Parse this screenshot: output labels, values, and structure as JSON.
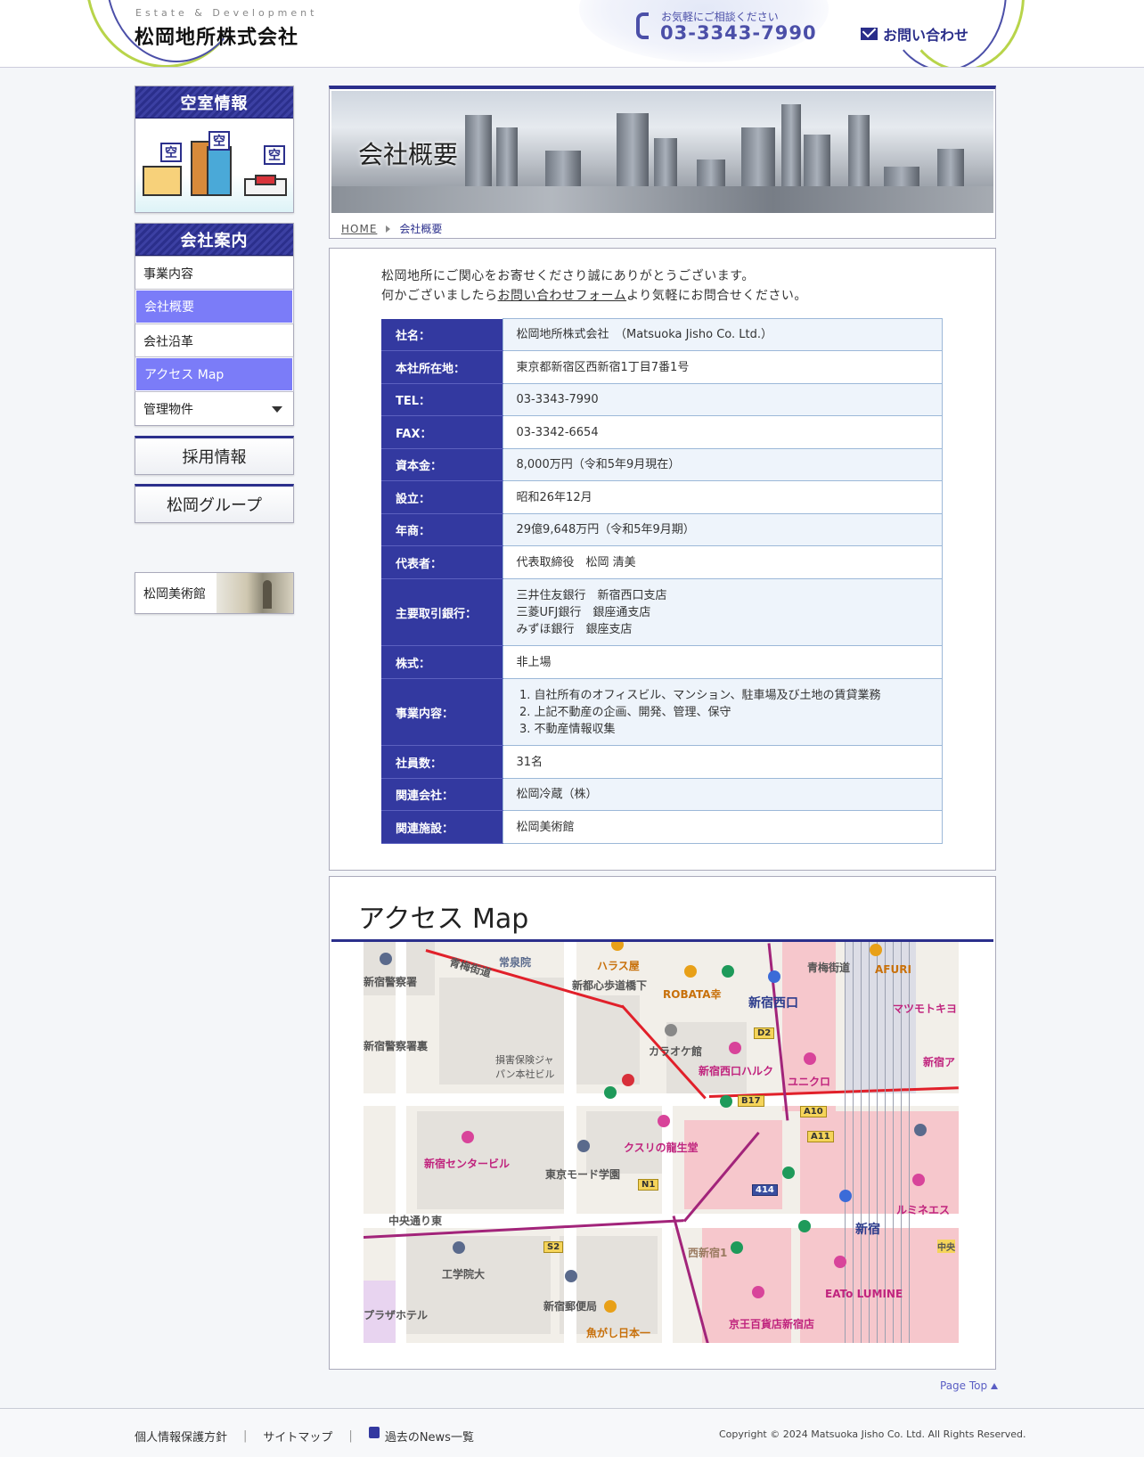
{
  "header": {
    "logo_sub": "Estate & Development",
    "logo_main": "松岡地所株式会社",
    "tel_note": "お気軽にご相談ください",
    "tel_number": "03-3343-7990",
    "contact_label": "お問い合わせ"
  },
  "sidebar": {
    "vacancy_title": "空室情報",
    "vacancy_signs": [
      "空",
      "空",
      "空"
    ],
    "company_title": "会社案内",
    "items": [
      {
        "label": "事業内容",
        "active": false
      },
      {
        "label": "会社概要",
        "active": true
      },
      {
        "label": "会社沿革",
        "active": false
      },
      {
        "label": "アクセス Map",
        "active": true
      },
      {
        "label": "管理物件",
        "active": false
      }
    ],
    "recruit_label": "採用情報",
    "group_label": "松岡グループ",
    "museum_label": "松岡美術館"
  },
  "hero": {
    "title": "会社概要",
    "breadcrumb_home": "HOME",
    "breadcrumb_current": "会社概要"
  },
  "intro": {
    "line1": "松岡地所にご関心をお寄せくださり誠にありがとうございます。",
    "line2_pre": "何かございましたら",
    "line2_link": "お問い合わせフォーム",
    "line2_post": "より気軽にお問合せください。"
  },
  "profile": {
    "rows": [
      {
        "label": "社名：",
        "value": "松岡地所株式会社　（Matsuoka Jisho Co. Ltd.）"
      },
      {
        "label": "本社所在地：",
        "value": "東京都新宿区西新宿1丁目7番1号"
      },
      {
        "label": "TEL：",
        "value": "03-3343-7990"
      },
      {
        "label": "FAX：",
        "value": "03-3342-6654"
      },
      {
        "label": "資本金：",
        "value": "8,000万円（令和5年9月現在）"
      },
      {
        "label": "設立：",
        "value": "昭和26年12月"
      },
      {
        "label": "年商：",
        "value": "29億9,648万円（令和5年9月期）"
      },
      {
        "label": "代表者：",
        "value": "代表取締役　松岡 清美"
      },
      {
        "label": "主要取引銀行：",
        "lines": [
          "三井住友銀行　新宿西口支店",
          "三菱UFJ銀行　銀座通支店",
          "みずほ銀行　銀座支店"
        ]
      },
      {
        "label": "株式：",
        "value": "非上場"
      },
      {
        "label": "事業内容：",
        "list": [
          "自社所有のオフィスビル、マンション、駐車場及び土地の賃貸業務",
          "上記不動産の企画、開発、管理、保守",
          "不動産情報収集"
        ]
      },
      {
        "label": "社員数：",
        "value": "31名"
      },
      {
        "label": "関連会社：",
        "value": "松岡冷蔵（株）"
      },
      {
        "label": "関連施設：",
        "value": "松岡美術館"
      }
    ]
  },
  "access": {
    "title": "アクセス Map",
    "map_labels": {
      "joseiin": "常泉院",
      "harasu": "ハラス屋",
      "afuri": "AFURI",
      "oume1": "青梅街道",
      "oume2": "青梅街道",
      "shinjuku_kosaten": "新都心歩道橋下",
      "robata": "ROBATA幸",
      "nishiguchi": "新宿西口",
      "matsumoto": "マツモトキヨ",
      "keisatsu": "新宿警察署",
      "keisatsu_ura": "新宿警察署裏",
      "sompo": "損害保険ジャパン本社ビル",
      "karaoke": "カラオケ館",
      "halc": "新宿西口ハルク",
      "uniqlo": "ユニクロ",
      "center_bldg": "新宿センタービル",
      "kusuri": "クスリの龍生堂",
      "mode": "東京モード学園",
      "chuo": "中央通り東",
      "kogakuin": "工学院大",
      "yubinkyoku": "新宿郵便局",
      "nishishinjuku1": "西新宿1",
      "shinjuku": "新宿",
      "lumine": "ルミネエス",
      "lumine_est": "EATo LUMINE",
      "keio": "京王百貨店新宿店",
      "uogashi": "魚がし日本一",
      "plaza": "プラザホテル",
      "shinjuku_a": "新宿ア",
      "chuo_r": "中央",
      "exit_d2": "D2",
      "exit_b17": "B17",
      "exit_a10": "A10",
      "exit_a11": "A11",
      "exit_n1": "N1",
      "exit_s2": "S2",
      "route_414": "414"
    }
  },
  "footer": {
    "pagetop": "Page Top",
    "privacy": "個人情報保護方針",
    "sitemap": "サイトマップ",
    "news": "過去のNews一覧",
    "separator": "|",
    "copyright": "Copyright © 2024 Matsuoka Jisho Co. Ltd. All Rights Reserved."
  },
  "colors": {
    "brand_navy": "#2b2f8c",
    "nav_active": "#7b7cf8",
    "table_header": "#3339a0",
    "accent_green": "#b8d44a"
  }
}
